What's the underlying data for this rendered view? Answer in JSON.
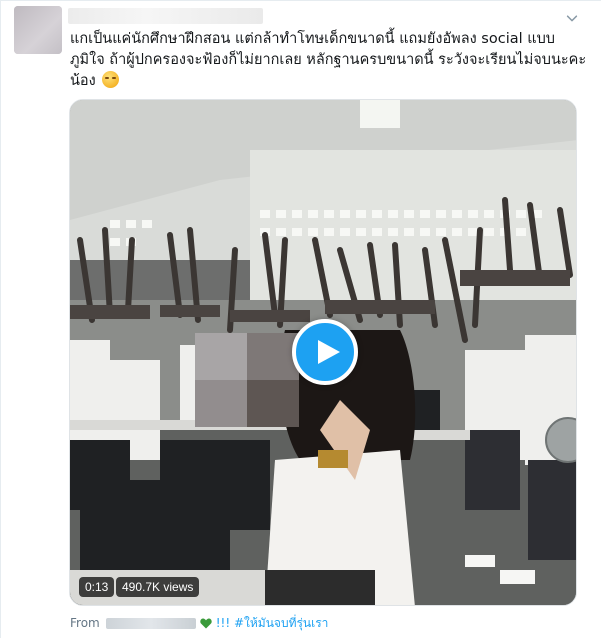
{
  "tweet": {
    "text_lines": [
      "แกเป็นแค่นักศึกษาฝึกสอน แต่กล้าทำโทษเด็กขนาดนี้ แถมยังอัพลง social แบบ",
      "ภูมิใจ ถ้าผู้ปกครองจะฟ้องก็ไม่ยากเลย หลักฐานครบขนาดนี้ ระวังจะเรียนไม่จบนะคะ",
      "น้อง"
    ],
    "emoji_icon": "face-with-rolling-eyes-emoji",
    "menu_icon": "chevron-down-icon"
  },
  "video": {
    "duration": "0:13",
    "views": "490.7K views",
    "play_icon": "play-icon"
  },
  "source": {
    "from_label": "From",
    "name": "!!! #ให้มันจบที่รุ่นเรา",
    "heart_color": "#3a9a3a"
  },
  "colors": {
    "accent": "#1da1f2",
    "text": "#14171a",
    "muted": "#657786"
  }
}
